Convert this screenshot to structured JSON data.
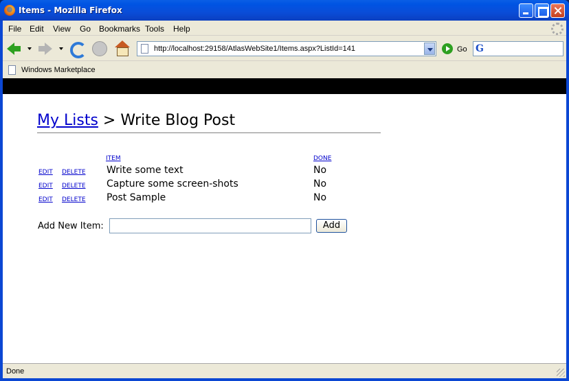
{
  "window": {
    "title": "Items - Mozilla Firefox",
    "colors": {
      "titlebar": "#0054e3",
      "frame": "#ece9d8"
    }
  },
  "menu": [
    "File",
    "Edit",
    "View",
    "Go",
    "Bookmarks",
    "Tools",
    "Help"
  ],
  "navbar": {
    "url": "http://localhost:29158/AtlasWebSite1/Items.aspx?ListId=141",
    "go_label": "Go",
    "search_icon_glyph": "G"
  },
  "bookmarks": [
    "Windows Marketplace"
  ],
  "page": {
    "breadcrumb_link": "My Lists",
    "breadcrumb_separator": ">",
    "list_title": "Write Blog Post",
    "columns": {
      "item": "ITEM",
      "done": "DONE"
    },
    "rows": [
      {
        "edit": "EDIT",
        "delete": "DELETE",
        "item": "Write some text",
        "done": "No"
      },
      {
        "edit": "EDIT",
        "delete": "DELETE",
        "item": "Capture some screen-shots",
        "done": "No"
      },
      {
        "edit": "EDIT",
        "delete": "DELETE",
        "item": "Post Sample",
        "done": "No"
      }
    ],
    "add_label": "Add New Item:",
    "add_input_value": "",
    "add_button": "Add",
    "link_color": "#0000cc"
  },
  "status": {
    "text": "Done"
  }
}
